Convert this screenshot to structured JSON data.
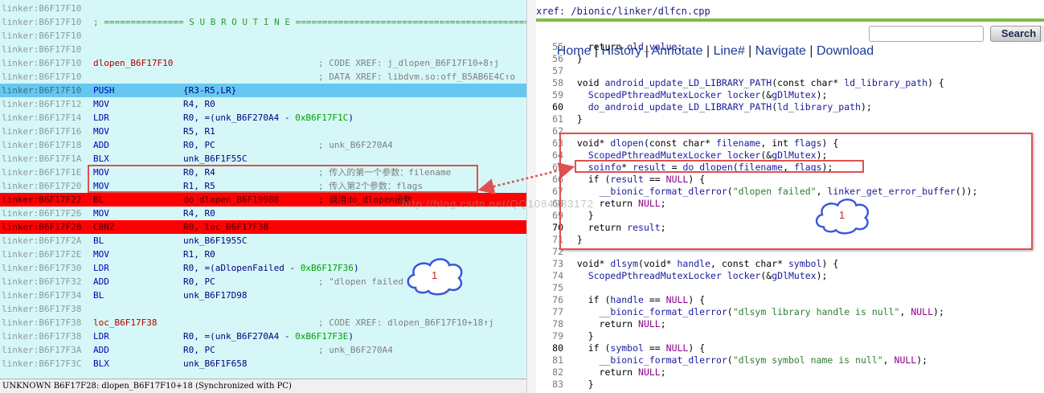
{
  "ida": {
    "lines": [
      {
        "addr": "linker:B6F17F10",
        "style": "",
        "label": "",
        "sep": "",
        "mn": "",
        "op": "",
        "hex": "",
        "op2": "",
        "cm": ""
      },
      {
        "addr": "linker:B6F17F10",
        "style": "",
        "label": "",
        "sep": "; =============== S U B R O U T I N E =======================================================",
        "mn": "",
        "op": "",
        "hex": "",
        "op2": "",
        "cm": ""
      },
      {
        "addr": "linker:B6F17F10",
        "style": "",
        "label": "",
        "sep": "",
        "mn": "",
        "op": "",
        "hex": "",
        "op2": "",
        "cm": ""
      },
      {
        "addr": "linker:B6F17F10",
        "style": "",
        "label": "",
        "sep": "",
        "mn": "",
        "op": "",
        "hex": "",
        "op2": "",
        "cm": ""
      },
      {
        "addr": "linker:B6F17F10",
        "style": "",
        "label": "dlopen_B6F17F10",
        "sep": "",
        "mn": "",
        "op": "",
        "hex": "",
        "op2": "",
        "cm": "; CODE XREF: j_dlopen_B6F17F10+8↑j"
      },
      {
        "addr": "linker:B6F17F10",
        "style": "",
        "label": "",
        "sep": "",
        "mn": "",
        "op": "",
        "hex": "",
        "op2": "",
        "cm": "; DATA XREF: libdvm.so:off_B5AB6E4C↑o"
      },
      {
        "addr": "linker:B6F17F10",
        "style": "sel",
        "label": "",
        "sep": "",
        "mn": "PUSH",
        "op": "{R3-R5,LR}",
        "hex": "",
        "op2": "",
        "cm": ""
      },
      {
        "addr": "linker:B6F17F12",
        "style": "",
        "label": "",
        "sep": "",
        "mn": "MOV",
        "op": "R4, R0",
        "hex": "",
        "op2": "",
        "cm": ""
      },
      {
        "addr": "linker:B6F17F14",
        "style": "",
        "label": "",
        "sep": "",
        "mn": "LDR",
        "op": "R0, =(unk_B6F270A4 - ",
        "hex": "0xB6F17F1C",
        "op2": ")",
        "cm": ""
      },
      {
        "addr": "linker:B6F17F16",
        "style": "",
        "label": "",
        "sep": "",
        "mn": "MOV",
        "op": "R5, R1",
        "hex": "",
        "op2": "",
        "cm": ""
      },
      {
        "addr": "linker:B6F17F18",
        "style": "",
        "label": "",
        "sep": "",
        "mn": "ADD",
        "op": "R0, PC",
        "hex": "",
        "op2": "",
        "cm": "; unk_B6F270A4"
      },
      {
        "addr": "linker:B6F17F1A",
        "style": "",
        "label": "",
        "sep": "",
        "mn": "BLX",
        "op": "unk_B6F1F55C",
        "hex": "",
        "op2": "",
        "cm": ""
      },
      {
        "addr": "linker:B6F17F1E",
        "style": "",
        "label": "",
        "sep": "",
        "mn": "MOV",
        "op": "R0, R4",
        "hex": "",
        "op2": "",
        "cm": "; 传入的第一个参数：filename"
      },
      {
        "addr": "linker:B6F17F20",
        "style": "",
        "label": "",
        "sep": "",
        "mn": "MOV",
        "op": "R1, R5",
        "hex": "",
        "op2": "",
        "cm": "; 传入第2个参数：flags"
      },
      {
        "addr": "linker:B6F17F22",
        "style": "bp",
        "label": "",
        "sep": "",
        "mn": "BL",
        "op": "do_dlopen_B6F19988",
        "hex": "",
        "op2": "",
        "cm": "; 调用do_dlopen函数"
      },
      {
        "addr": "linker:B6F17F26",
        "style": "",
        "label": "",
        "sep": "",
        "mn": "MOV",
        "op": "R4, R0",
        "hex": "",
        "op2": "",
        "cm": ""
      },
      {
        "addr": "linker:B6F17F28",
        "style": "bp",
        "label": "",
        "sep": "",
        "mn": "CBNZ",
        "op": "R0, loc_B6F17F38",
        "hex": "",
        "op2": "",
        "cm": ""
      },
      {
        "addr": "linker:B6F17F2A",
        "style": "",
        "label": "",
        "sep": "",
        "mn": "BL",
        "op": "unk_B6F1955C",
        "hex": "",
        "op2": "",
        "cm": ""
      },
      {
        "addr": "linker:B6F17F2E",
        "style": "",
        "label": "",
        "sep": "",
        "mn": "MOV",
        "op": "R1, R0",
        "hex": "",
        "op2": "",
        "cm": ""
      },
      {
        "addr": "linker:B6F17F30",
        "style": "",
        "label": "",
        "sep": "",
        "mn": "LDR",
        "op": "R0, =(aDlopenFailed - ",
        "hex": "0xB6F17F36",
        "op2": ")",
        "cm": ""
      },
      {
        "addr": "linker:B6F17F32",
        "style": "",
        "label": "",
        "sep": "",
        "mn": "ADD",
        "op": "R0, PC",
        "hex": "",
        "op2": "",
        "cm": "; \"dlopen failed"
      },
      {
        "addr": "linker:B6F17F34",
        "style": "",
        "label": "",
        "sep": "",
        "mn": "BL",
        "op": "unk_B6F17D98",
        "hex": "",
        "op2": "",
        "cm": ""
      },
      {
        "addr": "linker:B6F17F38",
        "style": "",
        "label": "",
        "sep": "",
        "mn": "",
        "op": "",
        "hex": "",
        "op2": "",
        "cm": ""
      },
      {
        "addr": "linker:B6F17F38",
        "style": "",
        "label": "loc_B6F17F38",
        "sep": "",
        "mn": "",
        "op": "",
        "hex": "",
        "op2": "",
        "cm": "; CODE XREF: dlopen_B6F17F10+18↑j"
      },
      {
        "addr": "linker:B6F17F38",
        "style": "",
        "label": "",
        "sep": "",
        "mn": "LDR",
        "op": "R0, =(unk_B6F270A4 - ",
        "hex": "0xB6F17F3E",
        "op2": ")",
        "cm": ""
      },
      {
        "addr": "linker:B6F17F3A",
        "style": "",
        "label": "",
        "sep": "",
        "mn": "ADD",
        "op": "R0, PC",
        "hex": "",
        "op2": "",
        "cm": "; unk_B6F270A4"
      },
      {
        "addr": "linker:B6F17F3C",
        "style": "",
        "label": "",
        "sep": "",
        "mn": "BLX",
        "op": "unk_B6F1F658",
        "hex": "",
        "op2": "",
        "cm": ""
      }
    ],
    "status": "UNKNOWN B6F17F28: dlopen_B6F17F10+18 (Synchronized with PC)"
  },
  "source": {
    "path": "xref: /bionic/linker/dlfcn.cpp",
    "nav": [
      "Home",
      "History",
      "Annotate",
      "Line#",
      "Navigate",
      "Download"
    ],
    "search_value": "",
    "search_button": "Search",
    "lines": [
      {
        "n": "55",
        "t": "    return old_value;"
      },
      {
        "n": "56",
        "t": "  }"
      },
      {
        "n": "57",
        "t": ""
      },
      {
        "n": "58",
        "t": "  void android_update_LD_LIBRARY_PATH(const char* ld_library_path) {"
      },
      {
        "n": "59",
        "t": "    ScopedPthreadMutexLocker locker(&gDlMutex);"
      },
      {
        "n": "60",
        "t": "    do_android_update_LD_LIBRARY_PATH(ld_library_path);"
      },
      {
        "n": "61",
        "t": "  }"
      },
      {
        "n": "62",
        "t": ""
      },
      {
        "n": "63",
        "t": "  void* dlopen(const char* filename, int flags) {"
      },
      {
        "n": "64",
        "t": "    ScopedPthreadMutexLocker locker(&gDlMutex);"
      },
      {
        "n": "65",
        "t": "    soinfo* result = do_dlopen(filename, flags);"
      },
      {
        "n": "66",
        "t": "    if (result == NULL) {"
      },
      {
        "n": "67",
        "t": "      __bionic_format_dlerror(\"dlopen failed\", linker_get_error_buffer());"
      },
      {
        "n": "68",
        "t": "      return NULL;"
      },
      {
        "n": "69",
        "t": "    }"
      },
      {
        "n": "70",
        "t": "    return result;"
      },
      {
        "n": "71",
        "t": "  }"
      },
      {
        "n": "72",
        "t": ""
      },
      {
        "n": "73",
        "t": "  void* dlsym(void* handle, const char* symbol) {"
      },
      {
        "n": "74",
        "t": "    ScopedPthreadMutexLocker locker(&gDlMutex);"
      },
      {
        "n": "75",
        "t": ""
      },
      {
        "n": "76",
        "t": "    if (handle == NULL) {"
      },
      {
        "n": "77",
        "t": "      __bionic_format_dlerror(\"dlsym library handle is null\", NULL);"
      },
      {
        "n": "78",
        "t": "      return NULL;"
      },
      {
        "n": "79",
        "t": "    }"
      },
      {
        "n": "80",
        "t": "    if (symbol == NULL) {"
      },
      {
        "n": "81",
        "t": "      __bionic_format_dlerror(\"dlsym symbol name is null\", NULL);"
      },
      {
        "n": "82",
        "t": "      return NULL;"
      },
      {
        "n": "83",
        "t": "    }"
      }
    ],
    "bold_lines": [
      "60",
      "70",
      "80"
    ]
  },
  "annotations": {
    "cloud_left": "1",
    "cloud_right": "1",
    "watermark": "http://blog.csdn.net/QQ1084283172"
  },
  "colors": {
    "ida_bg": "#d6f7f7",
    "ida_selected": "#66c8f0",
    "ida_breakpoint": "#ff0000",
    "annotation_red": "#e05050",
    "opengrok_green": "#7ac143"
  }
}
